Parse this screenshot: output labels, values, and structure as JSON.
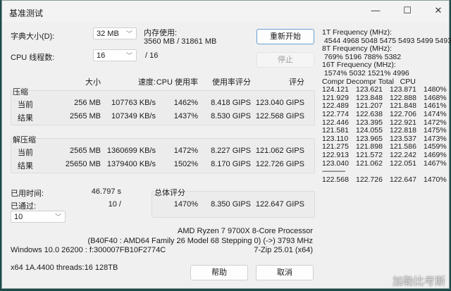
{
  "window": {
    "title": "基准测试",
    "minimize": "—",
    "maximize": "☐",
    "close": "✕"
  },
  "settings": {
    "dict_label": "字典大小(D):",
    "dict_value": "32 MB",
    "threads_label": "CPU 线程数:",
    "threads_value": "16",
    "threads_max": "/ 16",
    "mem_label": "内存使用:",
    "mem_value": "3560 MB / 31861 MB"
  },
  "buttons": {
    "restart": "重新开始",
    "stop": "停止",
    "help": "帮助",
    "cancel": "取消"
  },
  "headers": [
    "大小",
    "速度:",
    "CPU 使用率",
    "使用率评分",
    "评分"
  ],
  "compress": {
    "label": "压缩",
    "rows": [
      {
        "label": "当前",
        "cells": [
          "256 MB",
          "107763 KB/s",
          "1462%",
          "8.418 GIPS",
          "123.040 GIPS"
        ]
      },
      {
        "label": "结果",
        "cells": [
          "2565 MB",
          "107349 KB/s",
          "1437%",
          "8.530 GIPS",
          "122.568 GIPS"
        ]
      }
    ]
  },
  "decompress": {
    "label": "解压缩",
    "rows": [
      {
        "label": "当前",
        "cells": [
          "2565 MB",
          "1360699 KB/s",
          "1472%",
          "8.227 GIPS",
          "121.062 GIPS"
        ]
      },
      {
        "label": "结果",
        "cells": [
          "25650 MB",
          "1379400 KB/s",
          "1502%",
          "8.170 GIPS",
          "122.726 GIPS"
        ]
      }
    ]
  },
  "elapsed": {
    "label": "已用时间:",
    "value": "46.797 s"
  },
  "passed": {
    "label": "已通过:",
    "value": "10 /",
    "select": "10"
  },
  "total": {
    "label": "总体评分",
    "cpu": "1470%",
    "rating": "8.350 GIPS",
    "score": "122.647 GIPS"
  },
  "sysinfo": {
    "cpu": "AMD Ryzen 7 9700X 8-Core Processor",
    "cpu_detail": "(B40F40 : AMD64 Family 26 Model 68 Stepping 0) (->) 3793 MHz",
    "os": "Windows 10.0 26200 :  f:300007FB10F2774C",
    "version": "7-Zip 25.01 (x64)",
    "arch": "x64 1A.4400 threads:16 128TB"
  },
  "right_panel": {
    "lines": [
      "1T Frequency (MHz):",
      " 4544 4968 5048 5475 5493 5499 5493",
      "8T Frequency (MHz):",
      " 769% 5196 788% 5382",
      "16T Frequency (MHz):",
      " 1574% 5032 1521% 4996",
      "Compr Decompr Total   CPU"
    ],
    "rows": [
      [
        "124.121",
        "123.621",
        "123.871",
        "1480%"
      ],
      [
        "121.929",
        "123.848",
        "122.888",
        "1468%"
      ],
      [
        "122.489",
        "121.207",
        "121.848",
        "1461%"
      ],
      [
        "122.774",
        "122.638",
        "122.706",
        "1474%"
      ],
      [
        "122.446",
        "123.395",
        "122.921",
        "1472%"
      ],
      [
        "121.581",
        "124.055",
        "122.818",
        "1475%"
      ],
      [
        "123.110",
        "123.965",
        "123.537",
        "1473%"
      ],
      [
        "121.275",
        "121.898",
        "121.586",
        "1459%"
      ],
      [
        "122.913",
        "121.572",
        "122.242",
        "1469%"
      ],
      [
        "123.040",
        "121.062",
        "122.051",
        "1467%"
      ]
    ],
    "separator": "-------------",
    "total": [
      "122.568",
      "122.726",
      "122.647",
      "1470%"
    ]
  },
  "watermark": "加勒比考斯"
}
